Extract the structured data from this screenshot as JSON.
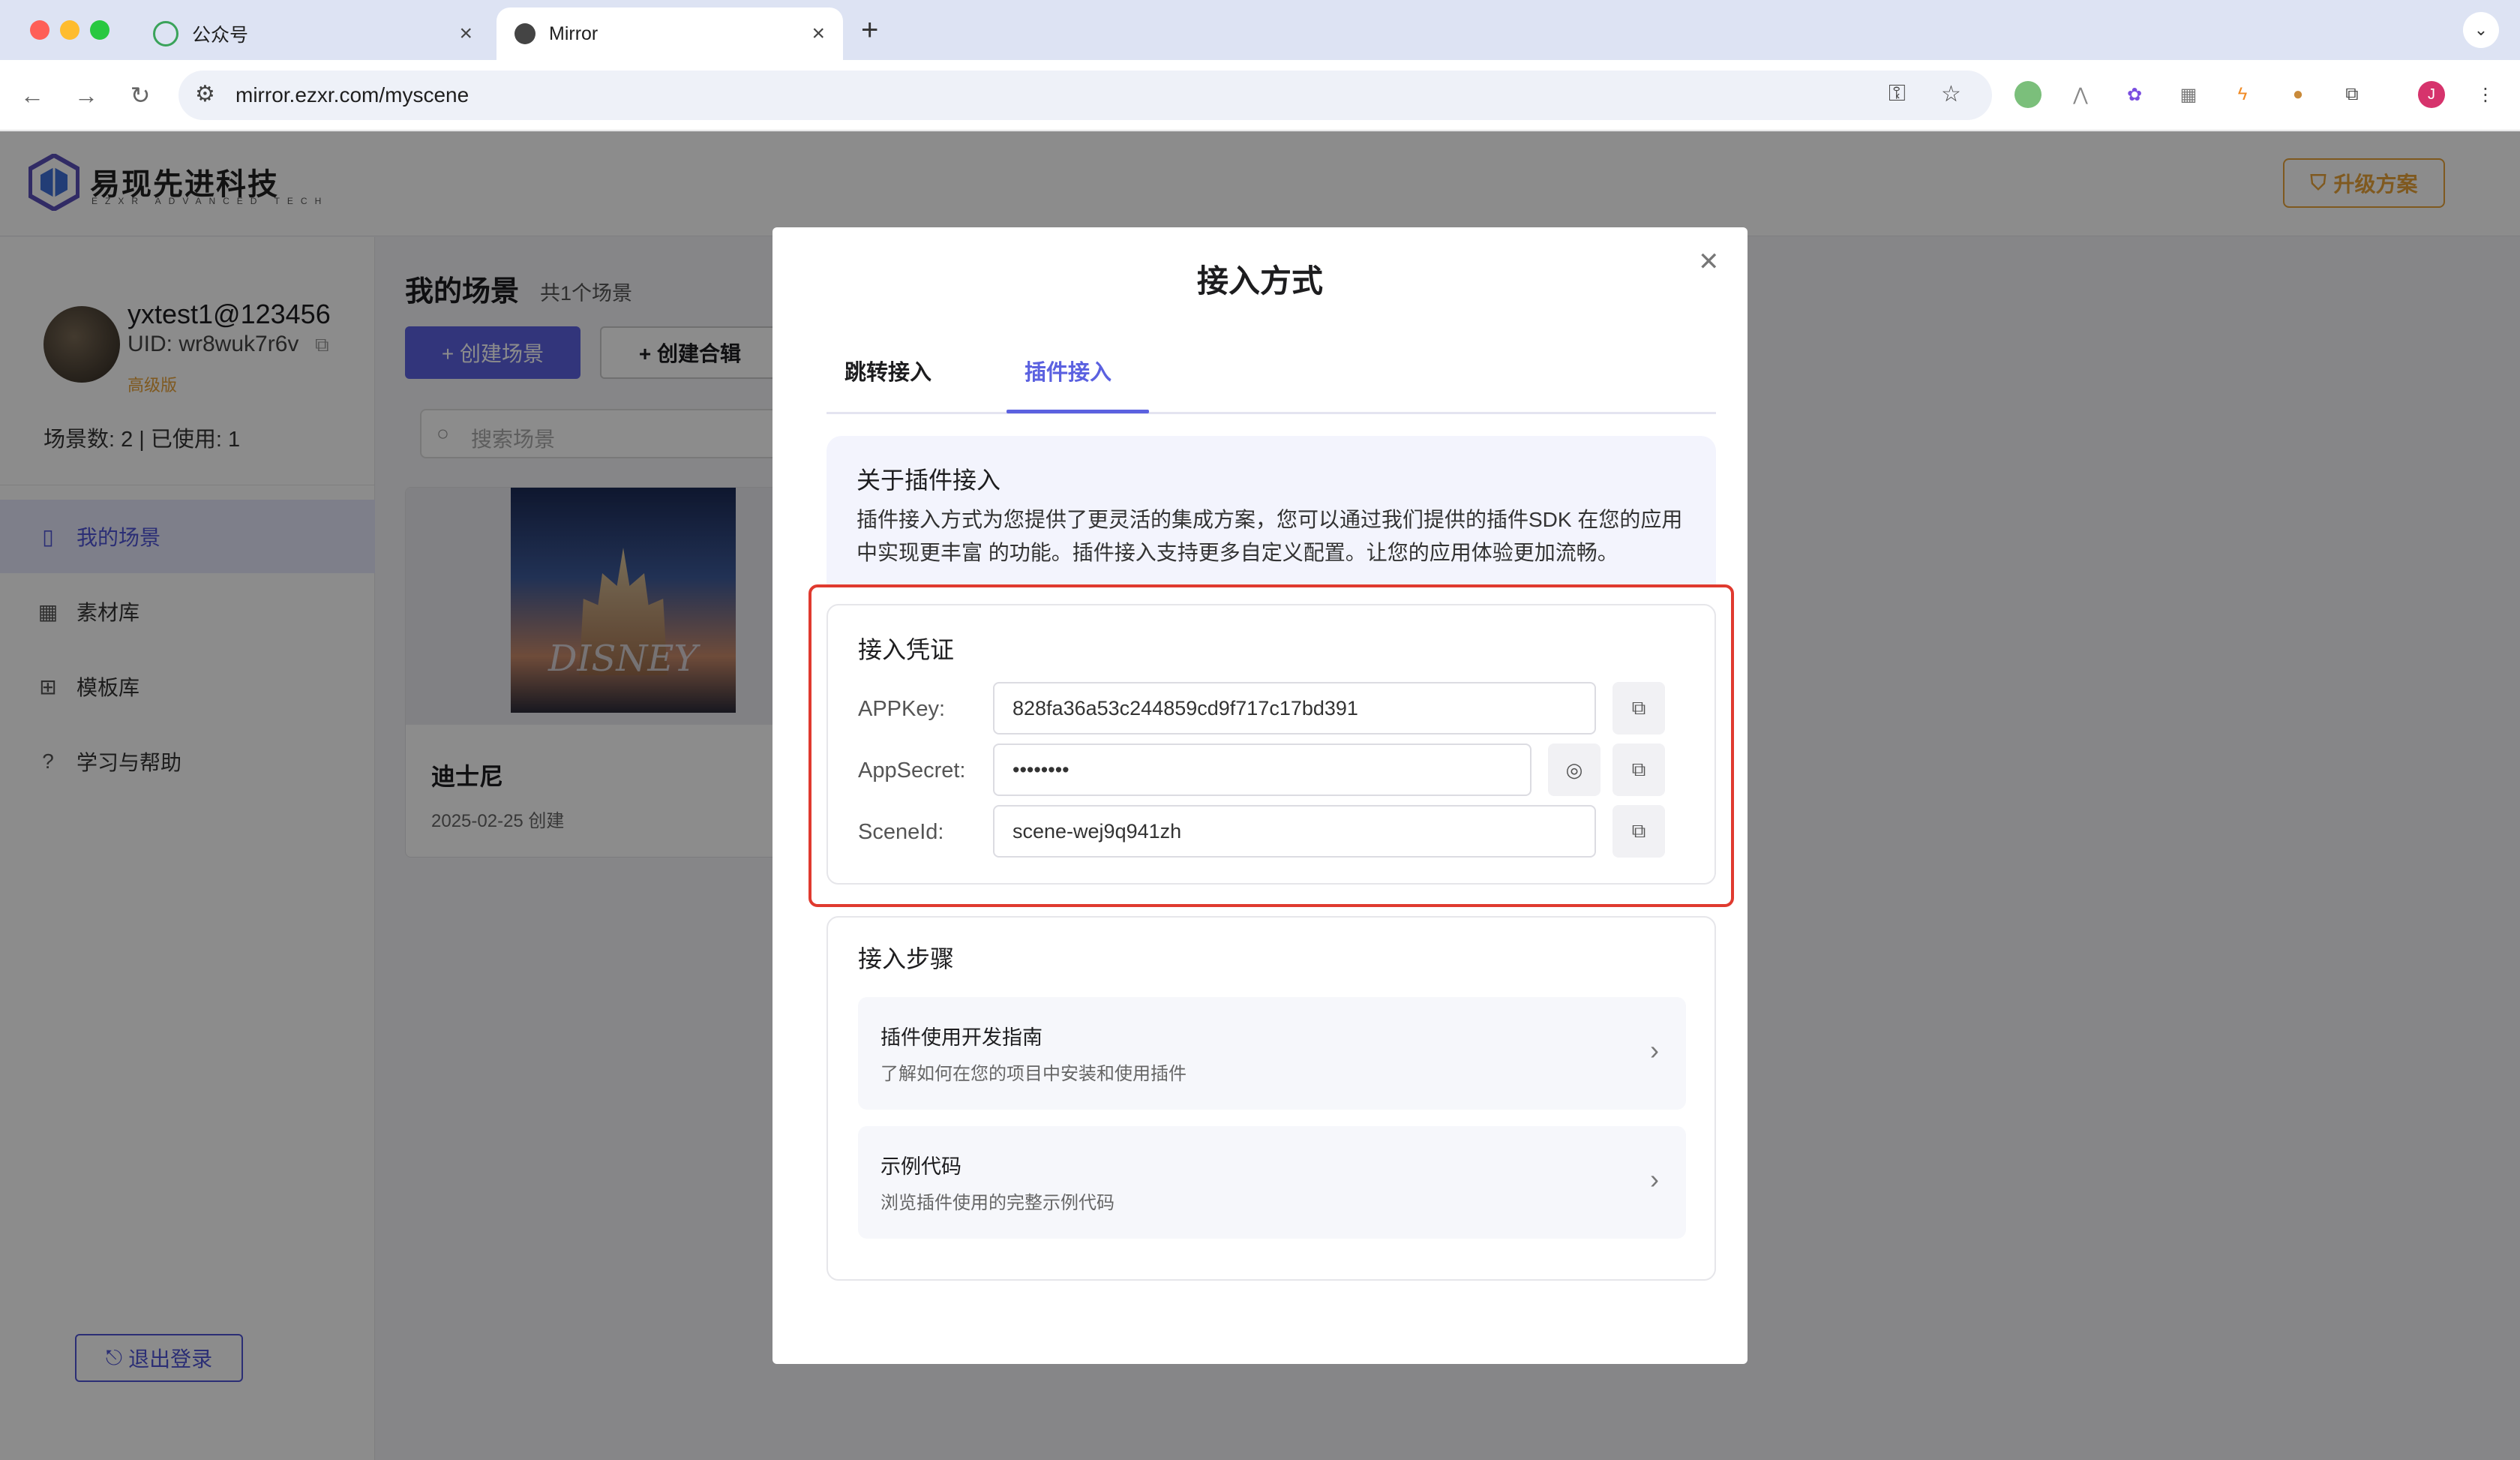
{
  "browser": {
    "tabs": [
      {
        "label": "公众号",
        "active": false
      },
      {
        "label": "Mirror",
        "active": true
      }
    ],
    "new_tab": "+",
    "tab_close": "×",
    "url": "mirror.ezxr.com/myscene",
    "profile_initial": "J"
  },
  "header": {
    "logo_cn": "易现先进科技",
    "logo_en": "EZXR ADVANCED TECH",
    "upgrade_label": "升级方案"
  },
  "sidebar": {
    "user_email": "yxtest1@123456",
    "uid": "UID: wr8wuk7r6v",
    "tier": "高级版",
    "scene_count": "场景数: 2 | 已使用: 1",
    "items": [
      {
        "label": "我的场景",
        "icon": "bookmark-icon",
        "active": true
      },
      {
        "label": "素材库",
        "icon": "grid-icon",
        "active": false
      },
      {
        "label": "模板库",
        "icon": "gift-icon",
        "active": false
      },
      {
        "label": "学习与帮助",
        "icon": "help-icon",
        "active": false
      }
    ],
    "logout_label": "退出登录"
  },
  "main": {
    "title": "我的场景",
    "subtitle": "共1个场景",
    "create_scene": "+ 创建场景",
    "create_collection": "+ 创建合辑",
    "search_placeholder": "搜索场景",
    "cards": [
      {
        "title": "迪士尼",
        "date": "2025-02-25 创建",
        "thumb_text": "DISNEY"
      }
    ]
  },
  "modal": {
    "title": "接入方式",
    "tabs": [
      {
        "label": "跳转接入",
        "active": false
      },
      {
        "label": "插件接入",
        "active": true
      }
    ],
    "about": {
      "title": "关于插件接入",
      "text": "插件接入方式为您提供了更灵活的集成方案，您可以通过我们提供的插件SDK 在您的应用中实现更丰富 的功能。插件接入支持更多自定义配置。让您的应用体验更加流畅。"
    },
    "credentials": {
      "title": "接入凭证",
      "fields": [
        {
          "label": "APPKey:",
          "value": "828fa36a53c244859cd9f717c17bd391"
        },
        {
          "label": "AppSecret:",
          "value": "••••••••"
        },
        {
          "label": "SceneId:",
          "value": "scene-wej9q941zh"
        }
      ]
    },
    "steps": {
      "title": "接入步骤",
      "items": [
        {
          "title": "插件使用开发指南",
          "desc": "了解如何在您的项目中安装和使用插件"
        },
        {
          "title": "示例代码",
          "desc": "浏览插件使用的完整示例代码"
        }
      ]
    }
  },
  "colors": {
    "accent": "#5b61e0",
    "highlight_frame": "#e03a2f",
    "upgrade": "#e8a23a"
  }
}
